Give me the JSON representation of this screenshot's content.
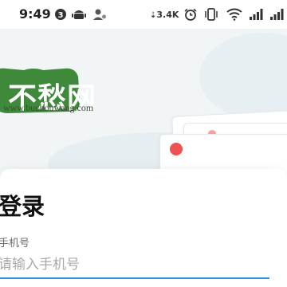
{
  "status_bar": {
    "time": "9:49",
    "notification_count": "3",
    "net_speed": "3.4K",
    "icons": [
      "notification-badge-icon",
      "android-icon",
      "person-icon",
      "download-speed-icon",
      "alarm-icon",
      "vibrate-icon",
      "wifi-icon",
      "signal-icon",
      "signal-icon"
    ]
  },
  "banner": {
    "logo_text": "不愁网",
    "logo_url": "www.buchouwang.com",
    "colors": {
      "logo_green": "#3f8a3a",
      "background": "#f1f5f6",
      "accent_red": "#f05252",
      "accent_teal": "#a7dcd9"
    }
  },
  "login": {
    "title": "登录",
    "phone_label": "手机号",
    "phone_placeholder": "请输入手机号",
    "phone_value": ""
  },
  "colors": {
    "input_underline": "#2e8fd6"
  }
}
